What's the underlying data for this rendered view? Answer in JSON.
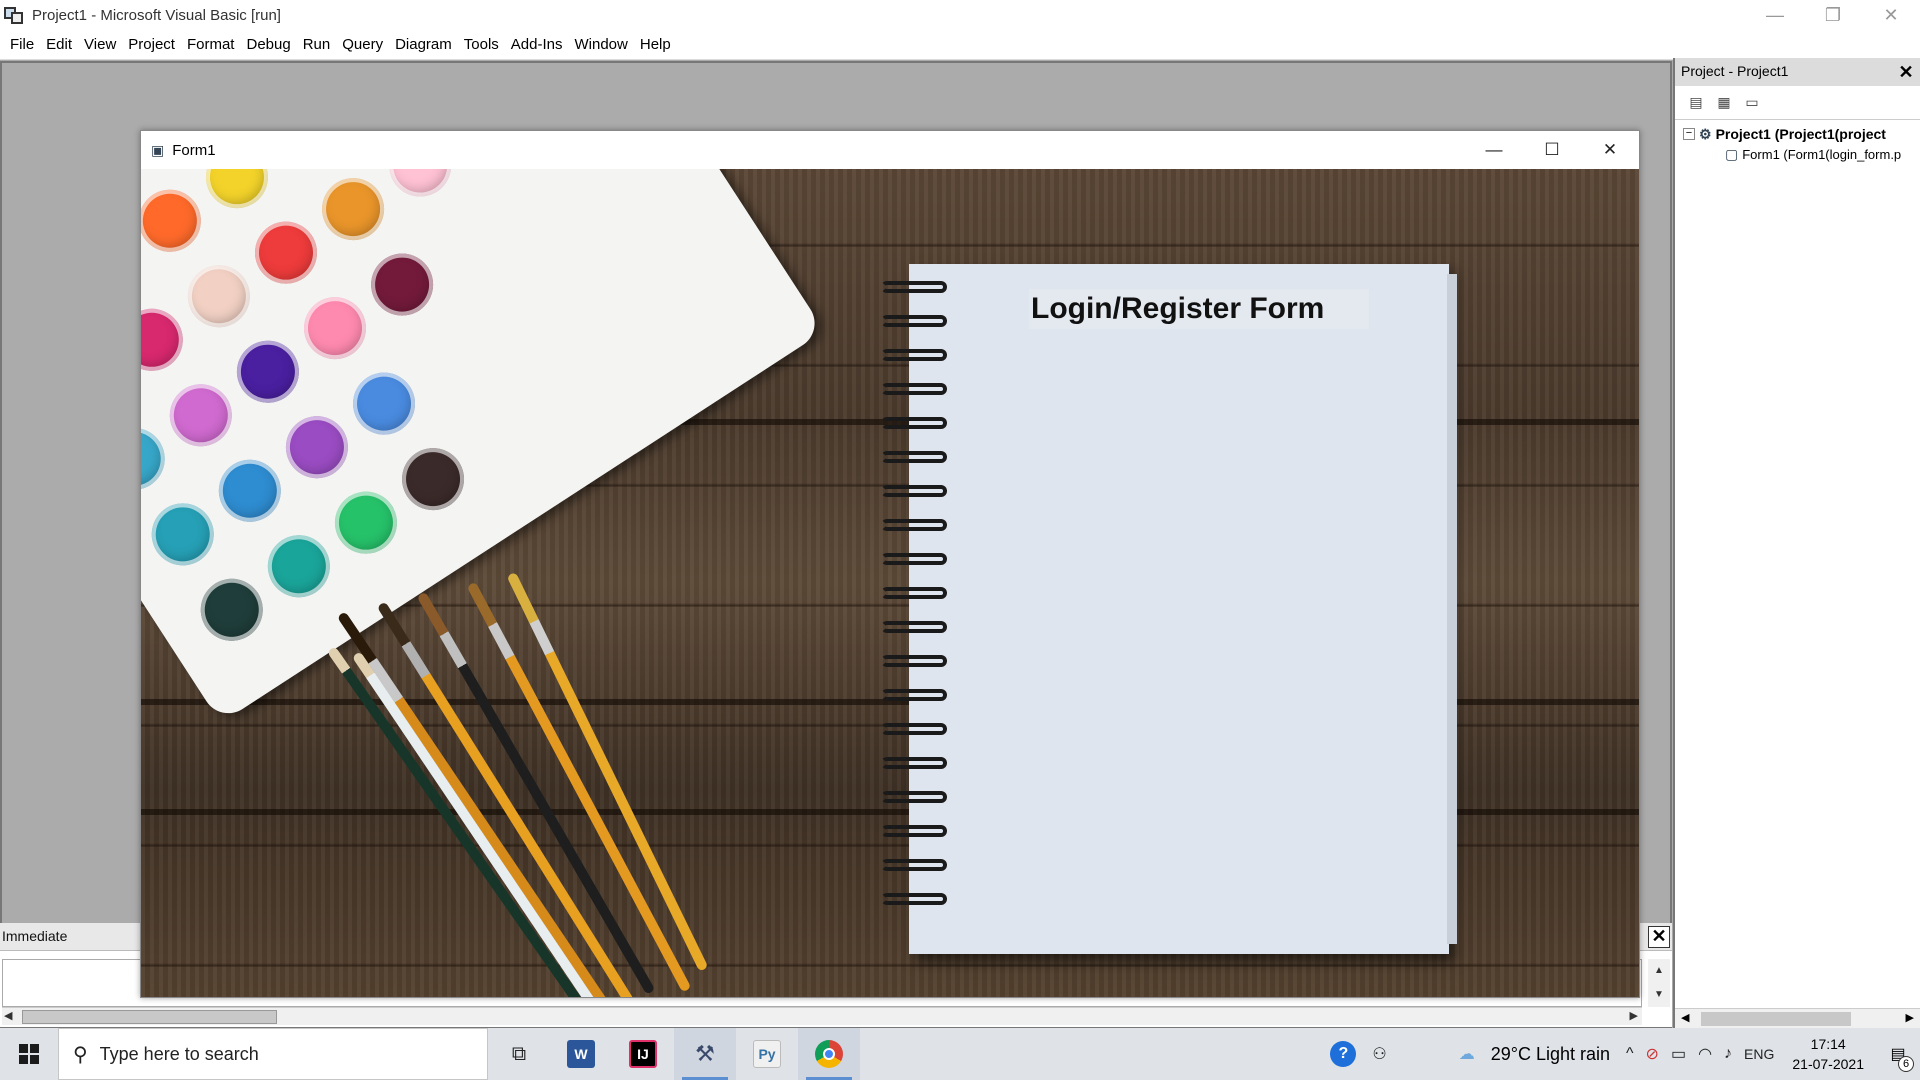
{
  "window": {
    "title": "Project1 - Microsoft Visual Basic [run]",
    "minimize_glyph": "—",
    "restore_glyph": "❐",
    "close_glyph": "✕"
  },
  "menu": [
    "File",
    "Edit",
    "View",
    "Project",
    "Format",
    "Debug",
    "Run",
    "Query",
    "Diagram",
    "Tools",
    "Add-Ins",
    "Window",
    "Help"
  ],
  "immediate": {
    "title": "Immediate",
    "close_glyph": "✕"
  },
  "project_panel": {
    "title": "Project - Project1",
    "close_glyph": "✕",
    "toolbar_icons": [
      "view-code-icon",
      "view-object-icon",
      "toggle-folders-icon"
    ],
    "tree": {
      "project_label": "Project1 (Project1(project",
      "form_label": "Form1 (Form1(login_form.p",
      "collapse_glyph": "−"
    }
  },
  "form1": {
    "title": "Form1",
    "minimize_glyph": "—",
    "maximize_glyph": "☐",
    "close_glyph": "✕",
    "heading": "Login/Register Form"
  },
  "taskbar": {
    "search_placeholder": "Type here to search",
    "apps": [
      "task-view-icon",
      "word-icon",
      "intellij-icon",
      "visual-basic-icon",
      "python-icon",
      "chrome-icon"
    ],
    "weather": "29°C  Light rain",
    "language": "ENG",
    "time": "17:14",
    "date": "21-07-2021",
    "notification_count": "6"
  },
  "colors": {
    "word": "#2b579a",
    "intellij": "#000000",
    "chrome": "#db4437",
    "accent": "#5b8fd2"
  }
}
